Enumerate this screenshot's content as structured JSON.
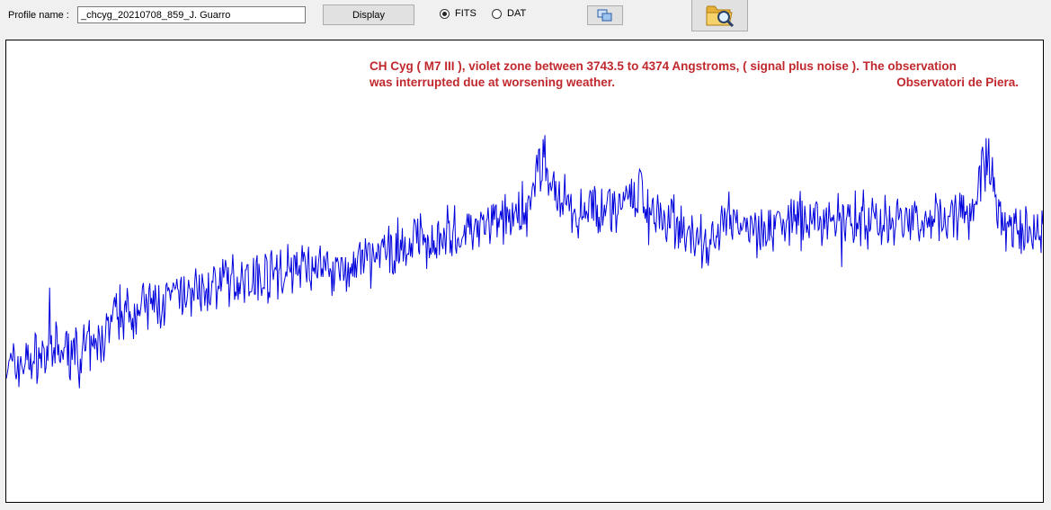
{
  "toolbar": {
    "profile_label": "Profile name :",
    "profile_value": "_chcyg_20210708_859_J. Guarro",
    "display_label": "Display",
    "format_options": [
      {
        "label": "FITS",
        "selected": true
      },
      {
        "label": "DAT",
        "selected": false
      }
    ],
    "copy_icon": "copy-icon",
    "open_icon": "folder-search-icon"
  },
  "plot": {
    "caption_line1": "CH Cyg ( M7 III ), violet zone between 3743.5 to 4374 Angstroms, ( signal plus noise ). The observation",
    "caption_line2": "was interrupted due at worsening weather.",
    "caption_credit": "Observatori de Piera.",
    "line_color": "#0000dd",
    "caption_color": "#c0282d"
  },
  "chart_data": {
    "type": "line",
    "title": "",
    "xlabel": "",
    "ylabel": "",
    "x_range": [
      3743.5,
      4374
    ],
    "grid": false,
    "series": [
      {
        "color": "#0000dd",
        "description_points_relative": [
          [
            3743.5,
            0.34
          ],
          [
            3770,
            0.37
          ],
          [
            3800,
            0.38
          ],
          [
            3810,
            0.46
          ],
          [
            3840,
            0.48
          ],
          [
            3870,
            0.52
          ],
          [
            3900,
            0.54
          ],
          [
            3930,
            0.56
          ],
          [
            3950,
            0.55
          ],
          [
            3970,
            0.58
          ],
          [
            4000,
            0.62
          ],
          [
            4030,
            0.64
          ],
          [
            4060,
            0.68
          ],
          [
            4070,
            0.8
          ],
          [
            4080,
            0.68
          ],
          [
            4100,
            0.68
          ],
          [
            4130,
            0.71
          ],
          [
            4150,
            0.66
          ],
          [
            4170,
            0.58
          ],
          [
            4180,
            0.66
          ],
          [
            4200,
            0.64
          ],
          [
            4230,
            0.66
          ],
          [
            4260,
            0.66
          ],
          [
            4300,
            0.66
          ],
          [
            4330,
            0.68
          ],
          [
            4340,
            0.8
          ],
          [
            4350,
            0.64
          ],
          [
            4374,
            0.62
          ]
        ]
      }
    ]
  }
}
